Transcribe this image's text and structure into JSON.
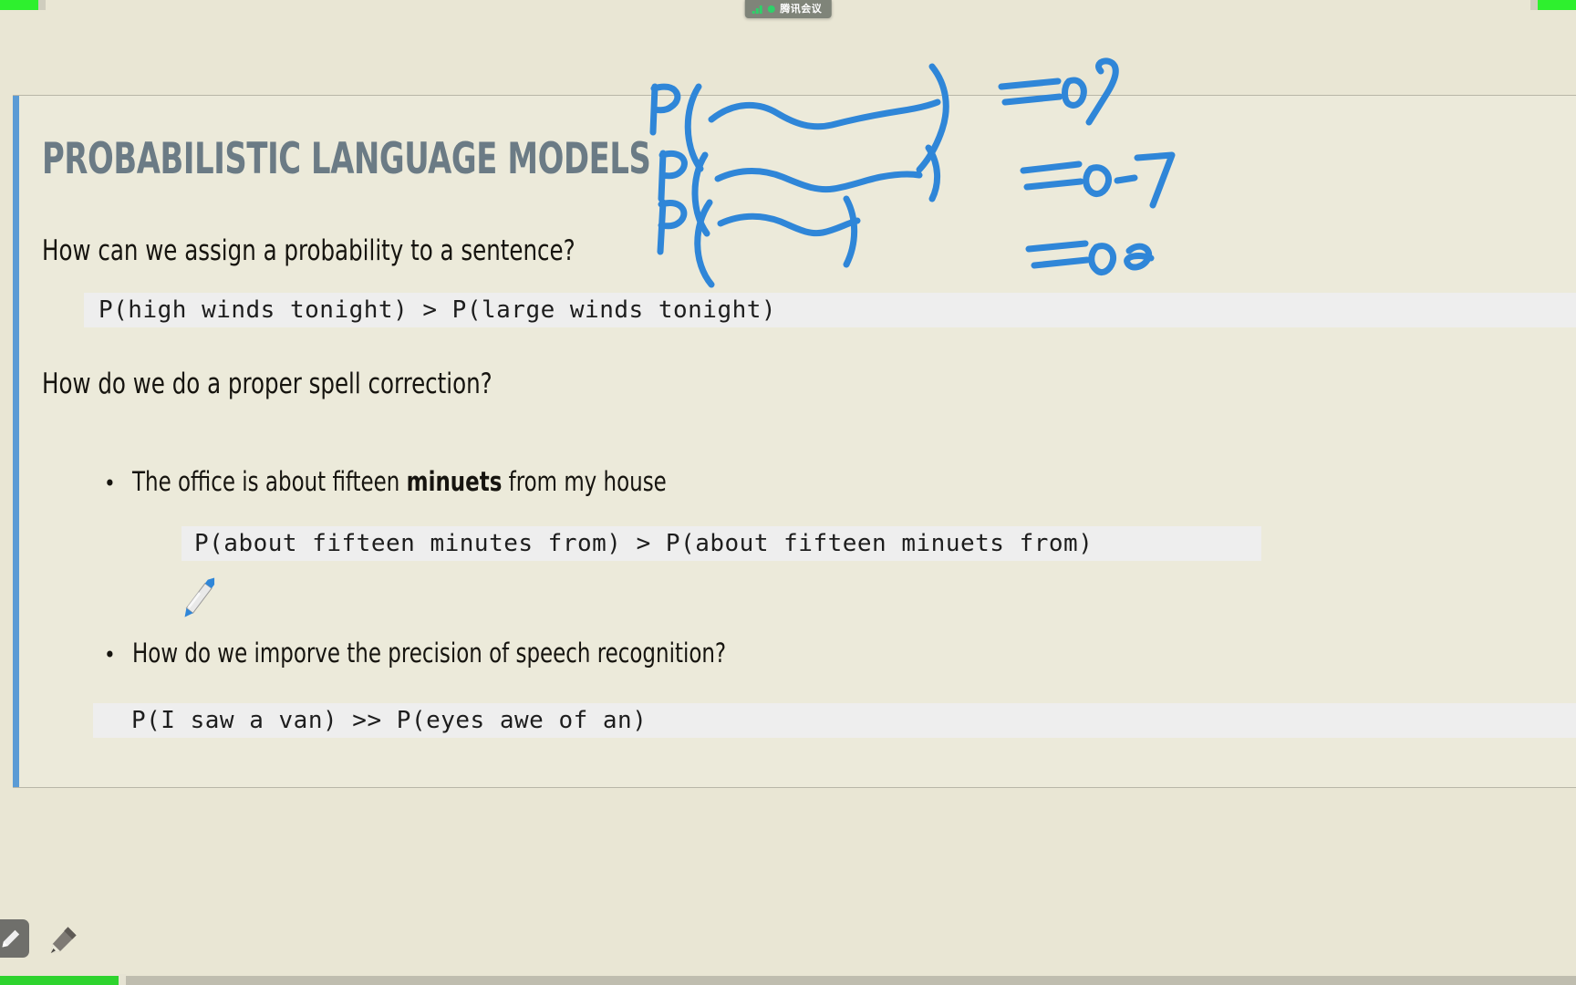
{
  "window": {
    "app_name": "腾讯会议",
    "share_indicator_color": "#2ef02e",
    "pill_background": "#7f8479"
  },
  "slide": {
    "title": "PROBABILISTIC LANGUAGE MODELS",
    "title_color": "#6b7b85",
    "accent_color": "#5b9bd5",
    "background": "#eceada",
    "questions": [
      "How can we assign a probability to a sentence?",
      "How do we do a proper spell correction?"
    ],
    "code_blocks": [
      "P(high winds tonight) > P(large winds tonight)",
      "P(about fifteen minutes from) > P(about fifteen minuets from)",
      "P(I saw a van) >> P(eyes awe of an)"
    ],
    "bullets": [
      {
        "marker": "•",
        "prefix": "The office is about fifteen ",
        "emphasis": "minuets",
        "suffix": " from my house"
      },
      {
        "marker": "•",
        "prefix": "How do we imporve the precision of speech recognition?",
        "emphasis": "",
        "suffix": ""
      }
    ]
  },
  "annotations": {
    "ink_color": "#2f86d8",
    "handwritten_terms": [
      {
        "label": "P(",
        "value": "= 0.9"
      },
      {
        "label": "P(",
        "value": "= 0.7"
      },
      {
        "label": "P(",
        "value": "= 0.2"
      }
    ]
  },
  "toolbar": {
    "pen_tool_label": "Pen",
    "pen_tool_active": "true",
    "highlighter_tool_label": "Pencil"
  },
  "progress": {
    "value_percent": 7.5,
    "fill_color": "#2ed32e",
    "track_color": "#bfbdaf"
  }
}
